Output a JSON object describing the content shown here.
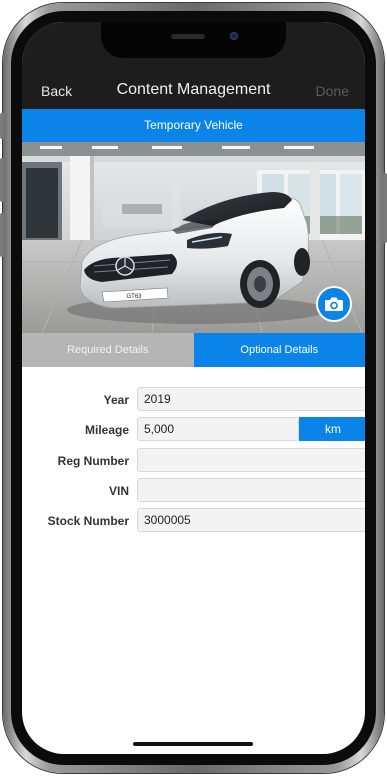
{
  "navbar": {
    "back_label": "Back",
    "title": "Content Management",
    "done_label": "Done"
  },
  "vehicle_bar": {
    "title": "Temporary Vehicle"
  },
  "tabs": [
    {
      "label": "Required Details",
      "active": false
    },
    {
      "label": "Optional Details",
      "active": true
    }
  ],
  "form": {
    "year": {
      "label": "Year",
      "value": "2019"
    },
    "mileage": {
      "label": "Mileage",
      "value": "5,000",
      "unit": "km"
    },
    "reg_number": {
      "label": "Reg Number",
      "value": ""
    },
    "vin": {
      "label": "VIN",
      "value": ""
    },
    "stock_number": {
      "label": "Stock Number",
      "value": "3000005"
    }
  },
  "photo": {
    "license_plate": "GT63"
  },
  "icons": {
    "camera": "camera-icon"
  },
  "colors": {
    "accent": "#0a84e8",
    "navbar_bg": "#1d1d1d",
    "inactive_tab": "#b5b5b5",
    "field_bg": "#f3f3f3"
  }
}
